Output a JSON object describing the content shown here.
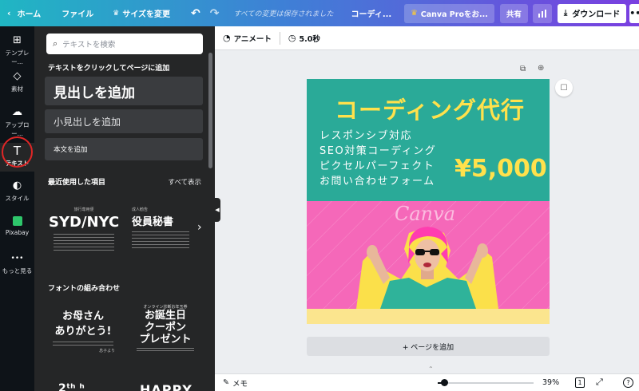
{
  "topbar": {
    "home": "ホーム",
    "file": "ファイル",
    "resize": "サイズを変更",
    "saved_status": "すべての変更は保存されました",
    "doc_title": "コーディ...",
    "pro_button": "Canva Proをお...",
    "share": "共有",
    "download": "ダウンロード"
  },
  "rail": {
    "templates": "テンプレー...",
    "elements": "素材",
    "uploads": "アップロー...",
    "text": "テキスト",
    "styles": "スタイル",
    "pixabay": "Pixabay",
    "more": "もっと見る"
  },
  "panel": {
    "search_placeholder": "テキストを検索",
    "click_to_add": "テキストをクリックしてページに追加",
    "heading": "見出しを追加",
    "subheading": "小見出しを追加",
    "body": "本文を追加",
    "recent": "最近使用した項目",
    "see_all": "すべて表示",
    "recent_thumb1_small": "旅行専用便",
    "recent_thumb1_main": "SYD/NYC",
    "recent_thumb2_small": "成人勧告",
    "recent_thumb2_main": "役員秘書",
    "font_combos": "フォントの組み合わせ",
    "combo1_line1": "お母さん",
    "combo1_line2": "ありがとう!",
    "combo1_sign": "息子より",
    "combo2_top": "オンライン診断お年玉券",
    "combo2_line1": "お誕生日",
    "combo2_line2": "クーポン",
    "combo2_line3": "プレゼント",
    "combo3_partial": "2ᵗʰ ʰ",
    "combo4_partial": "HAPPY"
  },
  "subbar": {
    "animate": "アニメート",
    "duration": "5.0秒"
  },
  "design": {
    "title": "コーディング代行",
    "bullets": [
      "レスポンシブ対応",
      "SEO対策コーディング",
      "ピクセルパーフェクト",
      "お問い合わせフォーム"
    ],
    "price": "¥5,000",
    "watermark": "Canva"
  },
  "canvas": {
    "add_page": "+ ページを追加"
  },
  "footer": {
    "notes": "メモ",
    "zoom": "39%",
    "page_count": "1",
    "help": "?"
  },
  "colors": {
    "teal": "#2aaa98",
    "pink": "#f568b9",
    "yellow": "#ffe14c",
    "cream": "#fbe58e",
    "rail_bg": "#0e1318",
    "panel_bg": "#252627"
  }
}
